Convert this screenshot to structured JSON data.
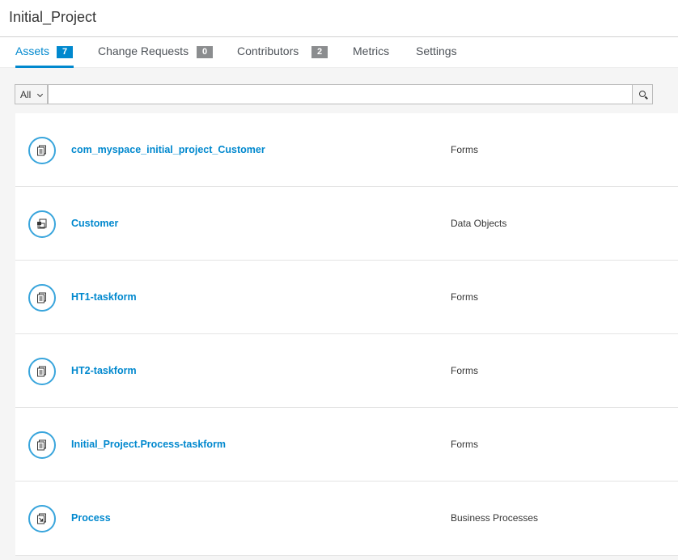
{
  "project": {
    "title": "Initial_Project"
  },
  "tabs": [
    {
      "label": "Assets",
      "badge": "7"
    },
    {
      "label": "Change Requests",
      "badge": "0"
    },
    {
      "label": "Contributors",
      "badge": "2"
    },
    {
      "label": "Metrics"
    },
    {
      "label": "Settings"
    }
  ],
  "filter": {
    "selected": "All",
    "search_value": ""
  },
  "assets": [
    {
      "name": "com_myspace_initial_project_Customer",
      "type": "Forms",
      "icon": "form-icon"
    },
    {
      "name": "Customer",
      "type": "Data Objects",
      "icon": "data-object-icon"
    },
    {
      "name": "HT1-taskform",
      "type": "Forms",
      "icon": "form-icon"
    },
    {
      "name": "HT2-taskform",
      "type": "Forms",
      "icon": "form-icon"
    },
    {
      "name": "Initial_Project.Process-taskform",
      "type": "Forms",
      "icon": "form-icon"
    },
    {
      "name": "Process",
      "type": "Business Processes",
      "icon": "process-icon"
    }
  ],
  "colors": {
    "accent": "#0088ce",
    "badge_gray": "#8b8d8f",
    "icon_ring": "#39a5dc"
  }
}
